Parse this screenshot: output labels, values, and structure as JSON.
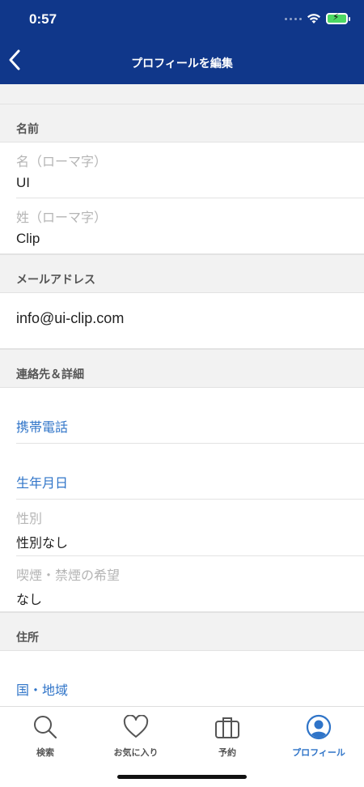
{
  "status": {
    "time": "0:57"
  },
  "header": {
    "title": "プロフィールを編集"
  },
  "sections": {
    "name": {
      "title": "名前",
      "first_name_label": "名（ローマ字）",
      "first_name_value": "UI",
      "last_name_label": "姓（ローマ字）",
      "last_name_value": "Clip"
    },
    "email": {
      "title": "メールアドレス",
      "value": "info@ui-clip.com"
    },
    "contact": {
      "title": "連絡先＆詳細",
      "mobile_label": "携帯電話",
      "birthday_label": "生年月日",
      "gender_label": "性別",
      "gender_value": "性別なし",
      "smoking_label": "喫煙・禁煙の希望",
      "smoking_value": "なし"
    },
    "address": {
      "title": "住所",
      "country_label": "国・地域"
    }
  },
  "tabbar": {
    "search": "検索",
    "favorites": "お気に入り",
    "bookings": "予約",
    "profile": "プロフィール",
    "active": "profile",
    "accent_color": "#2f74c8"
  },
  "colors": {
    "header_bg": "#10378a",
    "link": "#2f74c8"
  }
}
